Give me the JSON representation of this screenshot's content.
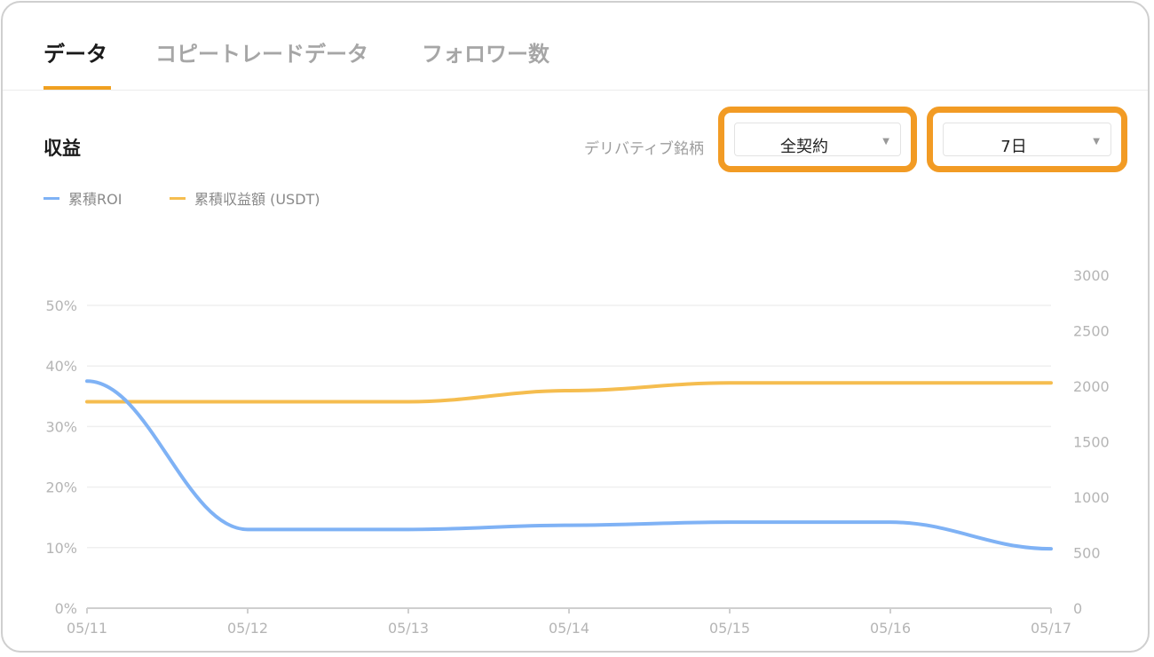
{
  "tabs": [
    {
      "label": "データ",
      "active": true
    },
    {
      "label": "コピートレードデータ",
      "active": false
    },
    {
      "label": "フォロワー数",
      "active": false
    }
  ],
  "section": {
    "title": "収益"
  },
  "filters": {
    "label": "デリバティブ銘柄",
    "contract": {
      "value": "全契約"
    },
    "period": {
      "value": "7日"
    }
  },
  "colors": {
    "roi": "#7fb2f5",
    "pnl": "#f5bd4f",
    "accent": "#f29b24"
  },
  "chart_data": {
    "type": "line",
    "title": "",
    "x": [
      "05/11",
      "05/12",
      "05/13",
      "05/14",
      "05/15",
      "05/16",
      "05/17"
    ],
    "y_left": {
      "ticks": [
        "0%",
        "10%",
        "20%",
        "30%",
        "40%",
        "50%"
      ],
      "ylim": [
        0,
        50
      ]
    },
    "y_right": {
      "ticks": [
        "0",
        "500",
        "1000",
        "1500",
        "2000",
        "2500",
        "3000"
      ],
      "ylim": [
        0,
        3000
      ]
    },
    "grid": true,
    "legend": "top-left",
    "series": [
      {
        "name": "累積ROI",
        "axis": "left",
        "values": [
          37.5,
          13.0,
          13.0,
          13.7,
          14.2,
          14.2,
          9.8
        ]
      },
      {
        "name": "累積収益額 (USDT)",
        "axis": "right",
        "values": [
          1860,
          1860,
          1860,
          1960,
          2030,
          2030,
          2030
        ]
      }
    ]
  }
}
